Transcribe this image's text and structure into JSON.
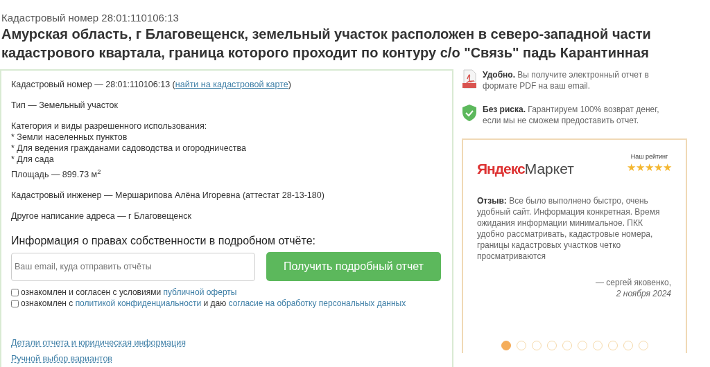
{
  "header": {
    "subtitle": "Кадастровый номер 28:01:110106:13",
    "title": "Амурская область, г Благовещенск, земельный участок расположен в северо-западной части кадастрового квартала, граница которого проходит по контуру с/о \"Связь\" падь Карантинная"
  },
  "details": [
    {
      "kind": "link_line",
      "before": "Кадастровый номер — 28:01:110106:13 (",
      "link": "найти на кадастровой карте",
      "after": ")"
    },
    {
      "kind": "text",
      "text": "Тип — Земельный участок"
    },
    {
      "kind": "list",
      "heading": "Категория и виды разрешенного использования:",
      "items": [
        "* Земли населенных пунктов",
        "* Для ведения гражданами садоводства и огородничества",
        "* Для сада"
      ]
    },
    {
      "kind": "text",
      "text": "Площадь — 899.73 м$^{2}$"
    },
    {
      "kind": "text",
      "text": "Кадастровый инженер — Мершарипова Алёна Игоревна (аттестат 28-13-180)"
    },
    {
      "kind": "text",
      "text": "Другое написание адреса — г Благовещенск"
    }
  ],
  "form": {
    "heading": "Информация о правах собственности в подробном отчёте:",
    "placeholder": "Ваш email, куда отправить отчёты",
    "button": "Получить подробный отчет",
    "agreements": [
      {
        "checked": false,
        "parts": [
          {
            "text": "ознакомлен и согласен с условиями "
          },
          {
            "link": "публичной оферты"
          }
        ]
      },
      {
        "checked": false,
        "parts": [
          {
            "text": "ознакомлен с "
          },
          {
            "link": "политикой конфиденциальности"
          },
          {
            "text": " и даю "
          },
          {
            "link": "согласие на обработку персональных данных"
          }
        ]
      }
    ]
  },
  "footer_links": [
    "Детали отчета и юридическая информация",
    "Ручной выбор вариантов"
  ],
  "features": [
    {
      "kind": "pdf",
      "text": "**Удобно.** Вы получите электронный отчет в формате PDF на ваш email."
    },
    {
      "kind": "shield",
      "text": "**Без риска.** Гарантируем 100% возврат денег, если мы не сможем предоставить отчет."
    }
  ],
  "review": {
    "logo_first": "Яндекс",
    "logo_second": "Маркет",
    "rating_label": "Наш рейтинг",
    "stars": 5,
    "text": "**Отзыв:** Все было выполнено быстро, очень удобный сайт. Информация конкретная. Время ожидания информации минимальное. ПКК удобно рассматривать, кадастровые номера, границы кадастровых участков четко просматриваются",
    "author": "— сергей яковенко,",
    "date": "2 ноября 2024",
    "dots": [
      {
        "selected": true
      },
      {
        "selected": false
      },
      {
        "selected": false
      },
      {
        "selected": false
      },
      {
        "selected": false
      },
      {
        "selected": false
      },
      {
        "selected": false
      },
      {
        "selected": false
      },
      {
        "selected": false
      },
      {
        "selected": false
      }
    ]
  }
}
